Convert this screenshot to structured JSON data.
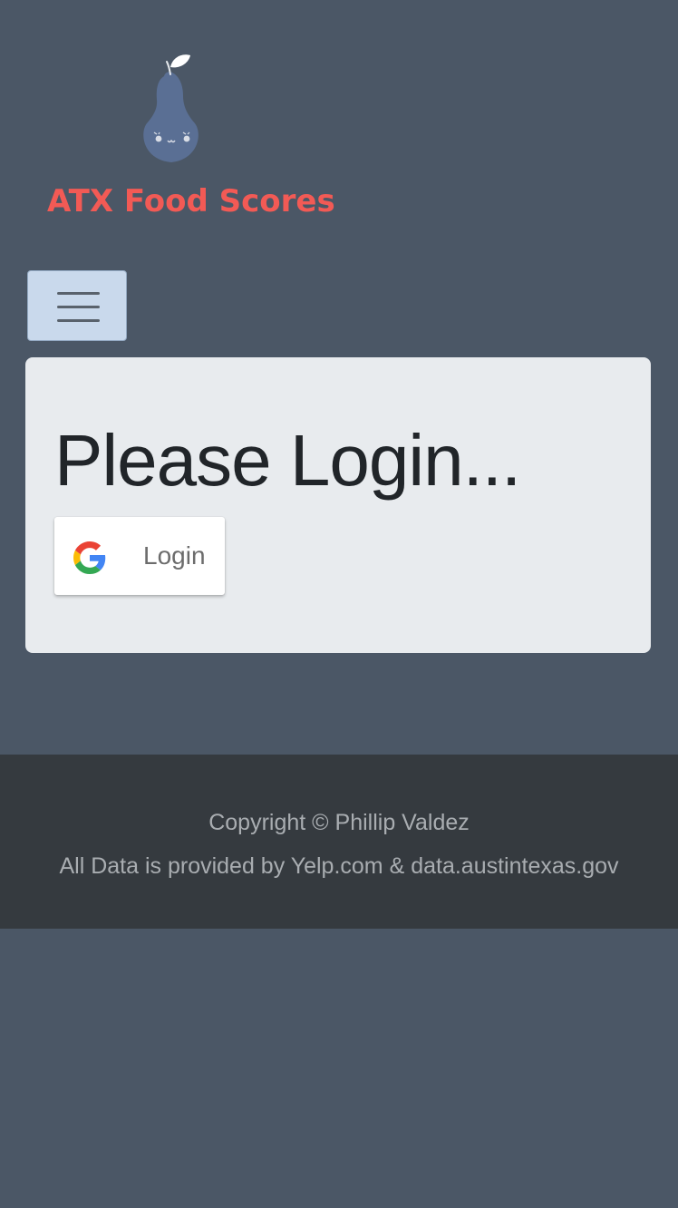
{
  "brand": {
    "name": "ATX Food Scores",
    "logo_icon": "pear-icon",
    "colors": {
      "name_text": "#f25a55",
      "pear": "#5a6f94",
      "leaf": "#ffffff"
    }
  },
  "navbar": {
    "toggler_icon": "hamburger-menu-icon",
    "toggler_bg": "#c9d9ec"
  },
  "main": {
    "heading": "Please Login...",
    "login_button": {
      "label": "Login",
      "icon": "google-icon"
    },
    "card_bg": "#e8ebee"
  },
  "footer": {
    "copyright": "Copyright © Phillip Valdez",
    "attribution": "All Data is provided by Yelp.com & data.austintexas.gov",
    "bg": "#353a3f"
  },
  "page_bg": "#4b5766"
}
